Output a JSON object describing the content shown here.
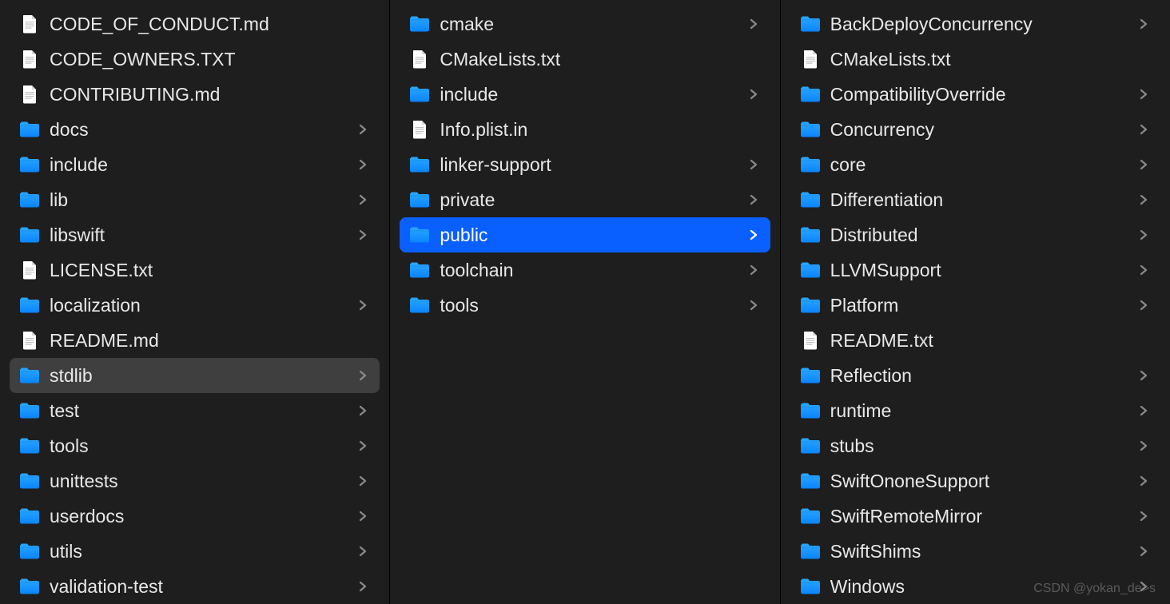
{
  "watermark": "CSDN @yokan_de>s",
  "columns": [
    {
      "id": "col0",
      "items": [
        {
          "type": "file",
          "name": "CODE_OF_CONDUCT.md",
          "isFolder": false
        },
        {
          "type": "file",
          "name": "CODE_OWNERS.TXT",
          "isFolder": false
        },
        {
          "type": "file",
          "name": "CONTRIBUTING.md",
          "isFolder": false
        },
        {
          "type": "folder",
          "name": "docs",
          "isFolder": true
        },
        {
          "type": "folder",
          "name": "include",
          "isFolder": true
        },
        {
          "type": "folder",
          "name": "lib",
          "isFolder": true
        },
        {
          "type": "folder",
          "name": "libswift",
          "isFolder": true
        },
        {
          "type": "file",
          "name": "LICENSE.txt",
          "isFolder": false
        },
        {
          "type": "folder",
          "name": "localization",
          "isFolder": true
        },
        {
          "type": "file",
          "name": "README.md",
          "isFolder": false
        },
        {
          "type": "folder",
          "name": "stdlib",
          "isFolder": true,
          "selected": "grey"
        },
        {
          "type": "folder",
          "name": "test",
          "isFolder": true
        },
        {
          "type": "folder",
          "name": "tools",
          "isFolder": true
        },
        {
          "type": "folder",
          "name": "unittests",
          "isFolder": true
        },
        {
          "type": "folder",
          "name": "userdocs",
          "isFolder": true
        },
        {
          "type": "folder",
          "name": "utils",
          "isFolder": true
        },
        {
          "type": "folder",
          "name": "validation-test",
          "isFolder": true
        }
      ]
    },
    {
      "id": "col1",
      "items": [
        {
          "type": "folder",
          "name": "cmake",
          "isFolder": true
        },
        {
          "type": "file",
          "name": "CMakeLists.txt",
          "isFolder": false
        },
        {
          "type": "folder",
          "name": "include",
          "isFolder": true
        },
        {
          "type": "file",
          "name": "Info.plist.in",
          "isFolder": false
        },
        {
          "type": "folder",
          "name": "linker-support",
          "isFolder": true
        },
        {
          "type": "folder",
          "name": "private",
          "isFolder": true
        },
        {
          "type": "folder",
          "name": "public",
          "isFolder": true,
          "selected": "blue"
        },
        {
          "type": "folder",
          "name": "toolchain",
          "isFolder": true
        },
        {
          "type": "folder",
          "name": "tools",
          "isFolder": true
        }
      ]
    },
    {
      "id": "col2",
      "items": [
        {
          "type": "folder",
          "name": "BackDeployConcurrency",
          "isFolder": true
        },
        {
          "type": "file",
          "name": "CMakeLists.txt",
          "isFolder": false
        },
        {
          "type": "folder",
          "name": "CompatibilityOverride",
          "isFolder": true
        },
        {
          "type": "folder",
          "name": "Concurrency",
          "isFolder": true
        },
        {
          "type": "folder",
          "name": "core",
          "isFolder": true
        },
        {
          "type": "folder",
          "name": "Differentiation",
          "isFolder": true
        },
        {
          "type": "folder",
          "name": "Distributed",
          "isFolder": true
        },
        {
          "type": "folder",
          "name": "LLVMSupport",
          "isFolder": true
        },
        {
          "type": "folder",
          "name": "Platform",
          "isFolder": true
        },
        {
          "type": "file",
          "name": "README.txt",
          "isFolder": false
        },
        {
          "type": "folder",
          "name": "Reflection",
          "isFolder": true
        },
        {
          "type": "folder",
          "name": "runtime",
          "isFolder": true
        },
        {
          "type": "folder",
          "name": "stubs",
          "isFolder": true
        },
        {
          "type": "folder",
          "name": "SwiftOnoneSupport",
          "isFolder": true
        },
        {
          "type": "folder",
          "name": "SwiftRemoteMirror",
          "isFolder": true
        },
        {
          "type": "folder",
          "name": "SwiftShims",
          "isFolder": true
        },
        {
          "type": "folder",
          "name": "Windows",
          "isFolder": true
        }
      ]
    }
  ]
}
